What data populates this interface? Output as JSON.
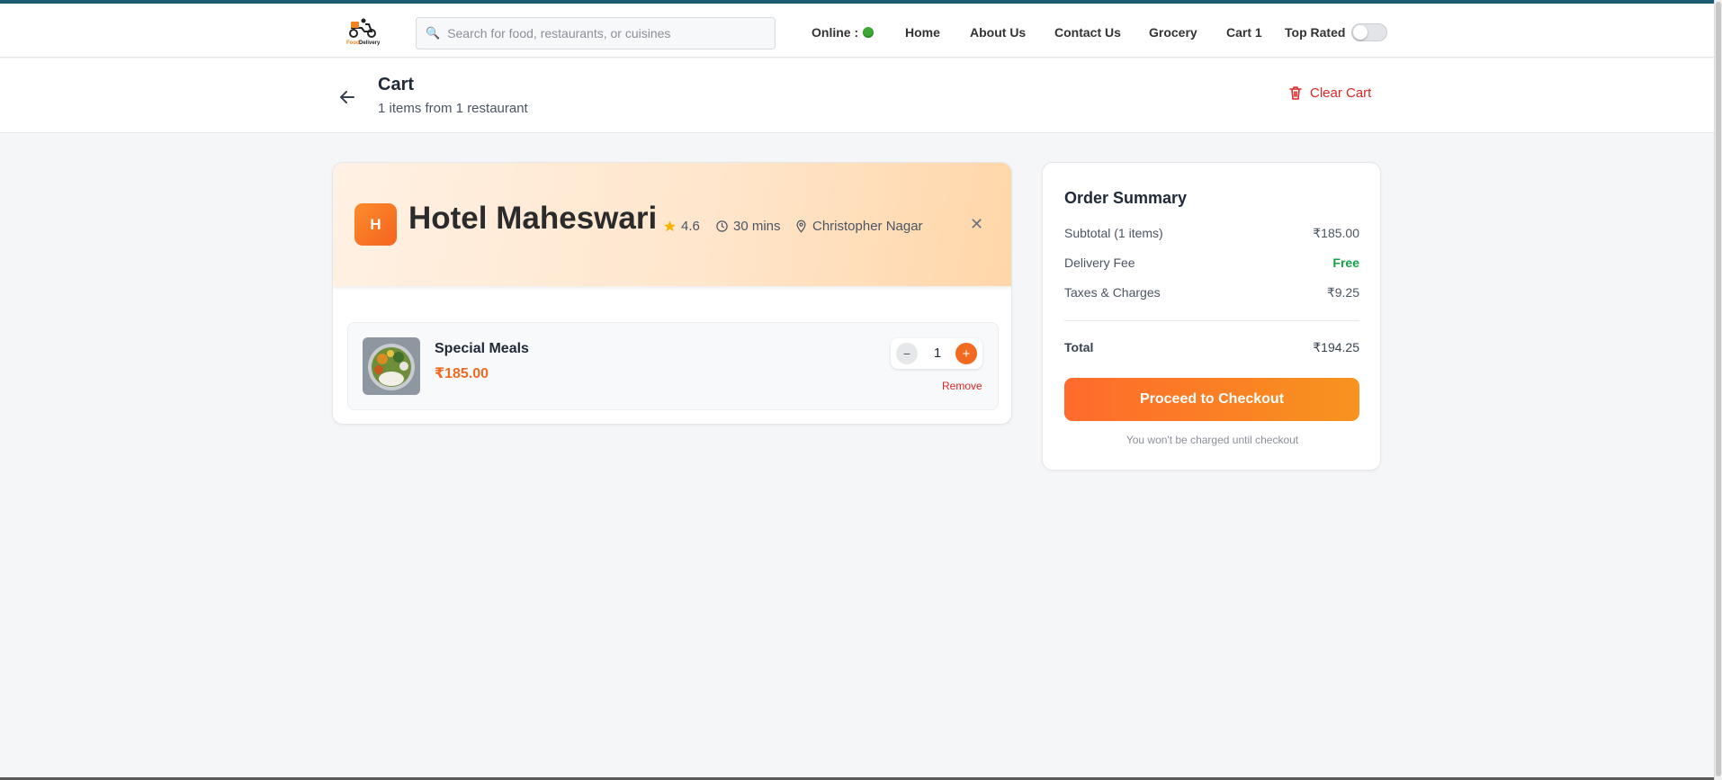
{
  "header": {
    "search_placeholder": "Search for food, restaurants, or cuisines",
    "online_label": "Online :",
    "nav": {
      "home": "Home",
      "about": "About Us",
      "contact": "Contact Us",
      "grocery": "Grocery",
      "cart": "Cart 1",
      "top_rated": "Top Rated"
    },
    "top_rated_toggle_on": false
  },
  "cart": {
    "title": "Cart",
    "subtitle": "1 items from 1 restaurant",
    "clear_label": "Clear Cart"
  },
  "restaurant": {
    "initial": "H",
    "name": "Hotel Maheswari",
    "rating": "4.6",
    "time": "30 mins",
    "location": "Christopher Nagar",
    "close_glyph": "✕",
    "items": [
      {
        "name": "Special Meals",
        "price": "₹185.00",
        "quantity": "1",
        "minus_glyph": "−",
        "plus_glyph": "+",
        "remove_label": "Remove"
      }
    ]
  },
  "summary": {
    "title": "Order Summary",
    "subtotal_label": "Subtotal (1 items)",
    "subtotal_value": "₹185.00",
    "delivery_label": "Delivery Fee",
    "delivery_value": "Free",
    "taxes_label": "Taxes & Charges",
    "taxes_value": "₹9.25",
    "total_label": "Total",
    "total_value": "₹194.25",
    "checkout_label": "Proceed to Checkout",
    "note": "You won't be charged until checkout"
  },
  "colors": {
    "accent": "#f26a21",
    "danger": "#dc2626",
    "success": "#15a34a",
    "topbar_border": "#1a5b73"
  },
  "icons": [
    "logo",
    "search-icon",
    "online-status-icon",
    "back-arrow-icon",
    "trash-icon",
    "star-icon",
    "clock-icon",
    "location-pin-icon",
    "close-icon",
    "minus-icon",
    "plus-icon"
  ]
}
